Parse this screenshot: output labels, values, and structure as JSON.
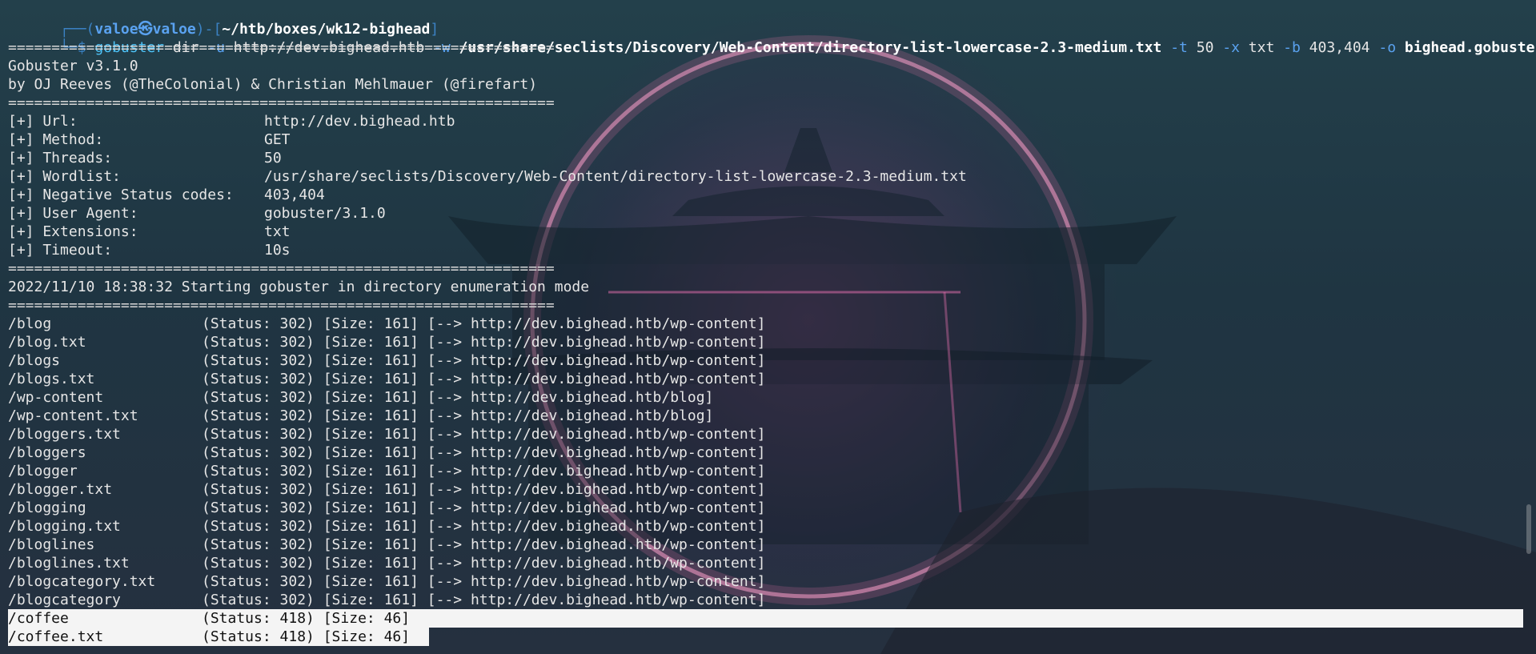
{
  "prompt": {
    "frame_open": "┌──(",
    "user": "valoe㉿valoe",
    "frame_mid": ")-[",
    "path": "~/htb/boxes/wk12-bighead",
    "frame_close": "]",
    "line2_prefix": "└─$ "
  },
  "command": {
    "name": "gobuster",
    "sub": " dir ",
    "flag_u": "-u",
    "url": " http://dev.bighead.htb ",
    "flag_w": "-w",
    "wordlist": " /usr/share/seclists/Discovery/Web-Content/directory-list-lowercase-2.3-medium.txt ",
    "flag_t": "-t",
    "threads": " 50 ",
    "flag_x": "-x",
    "ext": " txt ",
    "flag_b": "-b",
    "codes": " 403,404 ",
    "flag_o": "-o",
    "outfile": " bighead.gobuster"
  },
  "separator": "===============================================================",
  "banner": {
    "version": "Gobuster v3.1.0",
    "authors": "by OJ Reeves (@TheColonial) & Christian Mehlmauer (@firefart)"
  },
  "config": [
    {
      "key": "[+] Url:",
      "value": "http://dev.bighead.htb"
    },
    {
      "key": "[+] Method:",
      "value": "GET"
    },
    {
      "key": "[+] Threads:",
      "value": "50"
    },
    {
      "key": "[+] Wordlist:",
      "value": "/usr/share/seclists/Discovery/Web-Content/directory-list-lowercase-2.3-medium.txt"
    },
    {
      "key": "[+] Negative Status codes:",
      "value": "403,404"
    },
    {
      "key": "[+] User Agent:",
      "value": "gobuster/3.1.0"
    },
    {
      "key": "[+] Extensions:",
      "value": "txt"
    },
    {
      "key": "[+] Timeout:",
      "value": "10s"
    }
  ],
  "start_message": "2022/11/10 18:38:32 Starting gobuster in directory enumeration mode",
  "results": [
    {
      "path": "/blog",
      "info": "(Status: 302) [Size: 161] [--> http://dev.bighead.htb/wp-content]"
    },
    {
      "path": "/blog.txt",
      "info": "(Status: 302) [Size: 161] [--> http://dev.bighead.htb/wp-content]"
    },
    {
      "path": "/blogs",
      "info": "(Status: 302) [Size: 161] [--> http://dev.bighead.htb/wp-content]"
    },
    {
      "path": "/blogs.txt",
      "info": "(Status: 302) [Size: 161] [--> http://dev.bighead.htb/wp-content]"
    },
    {
      "path": "/wp-content",
      "info": "(Status: 302) [Size: 161] [--> http://dev.bighead.htb/blog]"
    },
    {
      "path": "/wp-content.txt",
      "info": "(Status: 302) [Size: 161] [--> http://dev.bighead.htb/blog]"
    },
    {
      "path": "/bloggers.txt",
      "info": "(Status: 302) [Size: 161] [--> http://dev.bighead.htb/wp-content]"
    },
    {
      "path": "/bloggers",
      "info": "(Status: 302) [Size: 161] [--> http://dev.bighead.htb/wp-content]"
    },
    {
      "path": "/blogger",
      "info": "(Status: 302) [Size: 161] [--> http://dev.bighead.htb/wp-content]"
    },
    {
      "path": "/blogger.txt",
      "info": "(Status: 302) [Size: 161] [--> http://dev.bighead.htb/wp-content]"
    },
    {
      "path": "/blogging",
      "info": "(Status: 302) [Size: 161] [--> http://dev.bighead.htb/wp-content]"
    },
    {
      "path": "/blogging.txt",
      "info": "(Status: 302) [Size: 161] [--> http://dev.bighead.htb/wp-content]"
    },
    {
      "path": "/bloglines",
      "info": "(Status: 302) [Size: 161] [--> http://dev.bighead.htb/wp-content]"
    },
    {
      "path": "/bloglines.txt",
      "info": "(Status: 302) [Size: 161] [--> http://dev.bighead.htb/wp-content]"
    },
    {
      "path": "/blogcategory.txt",
      "info": "(Status: 302) [Size: 161] [--> http://dev.bighead.htb/wp-content]"
    },
    {
      "path": "/blogcategory",
      "info": "(Status: 302) [Size: 161] [--> http://dev.bighead.htb/wp-content]"
    }
  ],
  "highlighted": [
    {
      "path": "/coffee",
      "info": "(Status: 418) [Size: 46]"
    },
    {
      "path": "/coffee.txt",
      "info": "(Status: 418) [Size: 46]"
    }
  ]
}
